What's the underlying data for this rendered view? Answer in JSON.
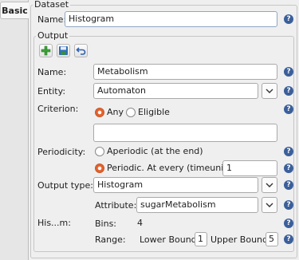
{
  "tabs": {
    "basic": "Basic"
  },
  "dataset": {
    "legend": "Dataset",
    "name_label": "Name:",
    "name_value": "Histogram"
  },
  "output": {
    "legend": "Output",
    "toolbar": {
      "add_icon": "plus-icon",
      "save_icon": "floppy-icon",
      "undo_icon": "undo-icon"
    },
    "name_label": "Name:",
    "name_value": "Metabolism",
    "entity_label": "Entity:",
    "entity_value": "Automaton",
    "criterion_label": "Criterion:",
    "criterion_any": "Any",
    "criterion_eligible": "Eligible",
    "periodicity_label": "Periodicity:",
    "aperiodic_label": "Aperiodic (at the end)",
    "periodic_label": "Periodic. At every (timeunits):",
    "periodic_value": "1",
    "output_type_label": "Output type:",
    "output_type_value": "Histogram",
    "attribute_label": "Attribute:",
    "attribute_value": "sugarMetabolism",
    "his_label": "His...m:",
    "bins_label": "Bins:",
    "bins_value": "4",
    "range_label": "Range:",
    "lower_label": "Lower Bound:",
    "lower_value": "1",
    "upper_label": "Upper Bound:",
    "upper_value": "5"
  },
  "help_glyph": "?",
  "colors": {
    "accent_radio": "#e4622b",
    "help": "#3b5f9a",
    "focus_border": "#8fa6c2"
  }
}
